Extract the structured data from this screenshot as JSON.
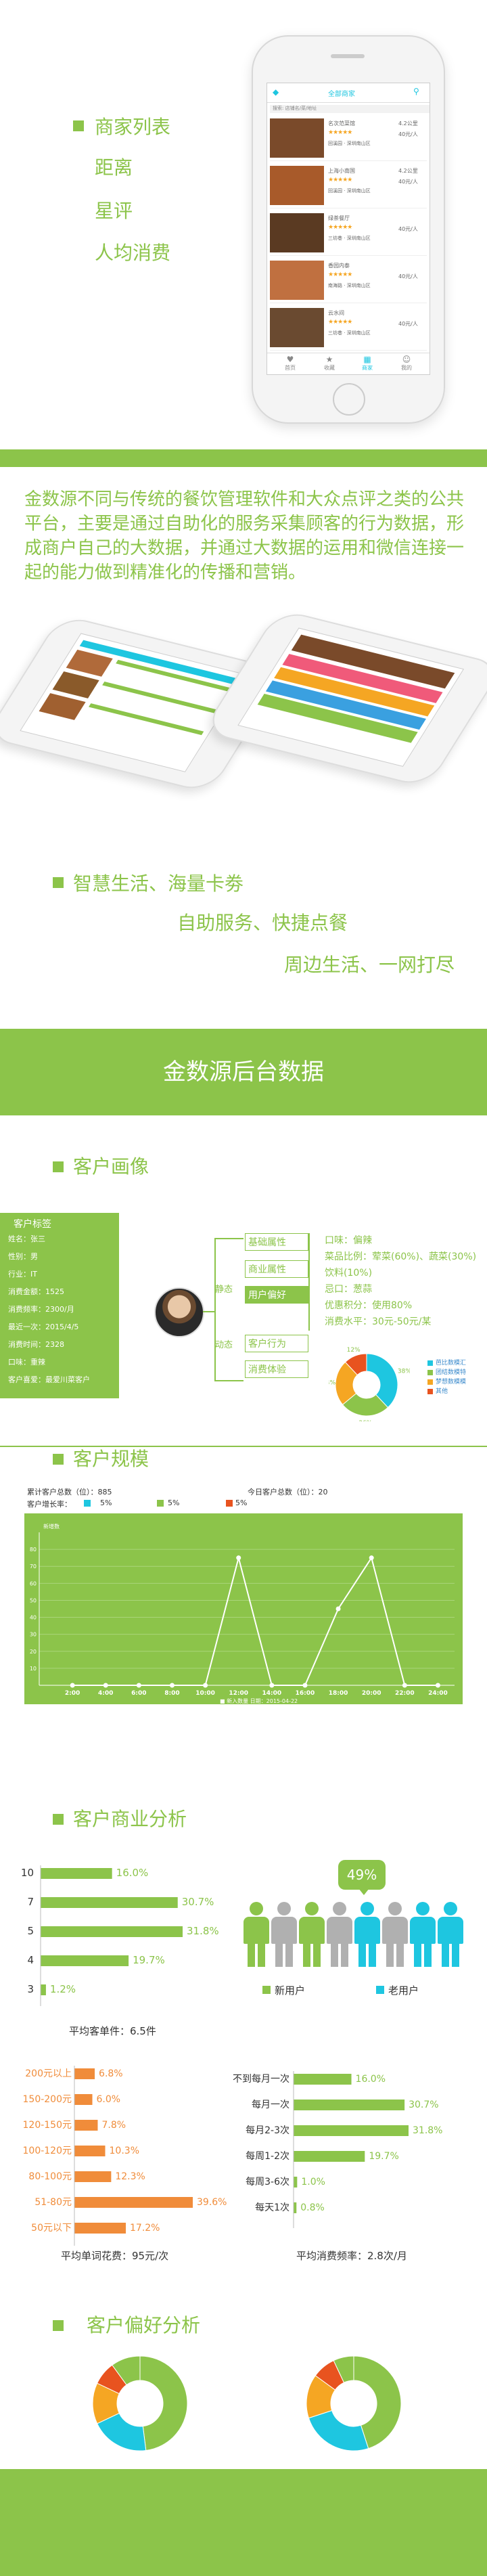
{
  "phone_app": {
    "header_title": "全部商家",
    "search_placeholder": "搜索: 店铺名/菜/地址",
    "restaurants": [
      {
        "name": "名次范菜馆",
        "dist": "4.2公里",
        "price": "40元/人",
        "area": "回溪园 · 深圳南山区"
      },
      {
        "name": "上海小南国",
        "dist": "4.2公里",
        "price": "40元/人",
        "area": "回溪园 · 深圳南山区"
      },
      {
        "name": "绿茶餐厅",
        "dist": "",
        "price": "40元/人",
        "area": "三坊巷 · 深圳南山区"
      },
      {
        "name": "香园内泰",
        "dist": "",
        "price": "40元/人",
        "area": "南海路 · 深圳南山区"
      },
      {
        "name": "云水间",
        "dist": "",
        "price": "40元/人",
        "area": "三坊巷 · 深圳南山区"
      }
    ],
    "tabs": [
      "首页",
      "收藏",
      "商家",
      "我的"
    ]
  },
  "features1": [
    "商家列表",
    "距离",
    "星评",
    "人均消费"
  ],
  "intro": "金数源不同与传统的餐饮管理软件和大众点评之类的公共平台，主要是通过自助化的服务采集顾客的行为数据，形成商户自己的大数据，并通过大数据的运用和微信连接一起的能力做到精准化的传播和营销。",
  "slogans": [
    "智慧生活、海量卡劵",
    "自助服务、快捷点餐",
    "周边生活、一网打尽"
  ],
  "banner": "金数源后台数据",
  "sections": {
    "portrait": "客户画像",
    "scale": "客户规模",
    "business": "客户商业分析",
    "preference": "客户偏好分析"
  },
  "portrait": {
    "card_title": "客户标签",
    "card_lines": [
      "姓名：张三",
      "性别：男",
      "行业：IT",
      "消费金额：1525",
      "消费频率：2300/月",
      "最近一次：2015/4/5",
      "消费时间：2328",
      "口味：重辣",
      "客户喜爱：最爱川菜客户"
    ],
    "static_label": "静态",
    "dynamic_label": "动态",
    "attrs": [
      "基础属性",
      "商业属性",
      "用户偏好",
      "客户行为",
      "消费体验"
    ],
    "pref_lines": [
      "口味：偏辣",
      "菜品比例：荤菜(60%)、蔬菜(30%)",
      "饮料(10%)",
      "忌口：葱蒜",
      "优惠积分：使用80%",
      "消费水平：30元-50元/某"
    ],
    "pie_legend": [
      "芭比数模汇",
      "团结数模特",
      "梦想数模模",
      "其他"
    ],
    "pie_values": [
      38,
      26,
      24,
      12
    ],
    "pie_labels": [
      "38%",
      "26%",
      "24%",
      "12%"
    ]
  },
  "scale": {
    "stat1": "累计客户总数（位）：885",
    "stat2": "今日客户总数（位）：20",
    "legend_label": "客户增长率：",
    "legend_items": [
      "5%",
      "5%",
      "5%"
    ],
    "y_label": "新增数",
    "footer": "■ 新入数量  日期：2015-04-22",
    "chart_data": {
      "type": "line",
      "x": [
        "2:00",
        "4:00",
        "6:00",
        "8:00",
        "10:00",
        "12:00",
        "14:00",
        "16:00",
        "18:00",
        "20:00",
        "22:00",
        "24:00"
      ],
      "series": [
        {
          "values": [
            0,
            0,
            0,
            0,
            0,
            75,
            0,
            0,
            45,
            75,
            0,
            0
          ]
        }
      ],
      "y_ticks": [
        "10",
        "20",
        "30",
        "40",
        "50",
        "60",
        "70",
        "80"
      ],
      "ylim": [
        0,
        90
      ],
      "grid": true
    }
  },
  "business": {
    "chart_data": {
      "type": "bar",
      "categories": [
        "10",
        "7",
        "5",
        "4",
        "3"
      ],
      "values": [
        16.0,
        30.7,
        31.8,
        19.7,
        1.2
      ],
      "value_labels": [
        "16.0%",
        "30.7%",
        "31.8%",
        "19.7%",
        "1.2%"
      ]
    },
    "avg_order": "平均客单件：6.5件",
    "bubble": "49%",
    "new_user": "新用户",
    "old_user": "老用户",
    "spend": {
      "type": "bar",
      "categories": [
        "200元以上",
        "150-200元",
        "120-150元",
        "100-120元",
        "80-100元",
        "51-80元",
        "50元以下"
      ],
      "values": [
        6.8,
        6.0,
        7.8,
        10.3,
        12.3,
        39.6,
        17.2
      ],
      "value_labels": [
        "6.8%",
        "6.0%",
        "7.8%",
        "10.3%",
        "12.3%",
        "39.6%",
        "17.2%"
      ]
    },
    "spend_caption": "平均单词花费：95元/次",
    "freq": {
      "type": "bar",
      "categories": [
        "不到每月一次",
        "每月一次",
        "每月2-3次",
        "每周1-2次",
        "每周3-6次",
        "每天1次"
      ],
      "values": [
        16.0,
        30.7,
        31.8,
        19.7,
        1.0,
        0.8
      ],
      "value_labels": [
        "16.0%",
        "30.7%",
        "31.8%",
        "19.7%",
        "1.0%",
        "0.8%"
      ]
    },
    "freq_caption": "平均消费频率：2.8次/月"
  },
  "preference_pies": [
    {
      "values": [
        48,
        20,
        14,
        8,
        10
      ],
      "colors": [
        "#8cc44a",
        "#1ec6e0",
        "#f5a623",
        "#e8531f",
        "#8cc44a"
      ]
    },
    {
      "values": [
        45,
        25,
        15,
        8,
        7
      ],
      "colors": [
        "#8cc44a",
        "#1ec6e0",
        "#f5a623",
        "#e8531f",
        "#8cc44a"
      ]
    }
  ],
  "colors": {
    "green": "#8cc44a",
    "orange": "#f08c3a",
    "cyan": "#1ec6e0",
    "yellow": "#f5a623",
    "red": "#e8531f"
  }
}
